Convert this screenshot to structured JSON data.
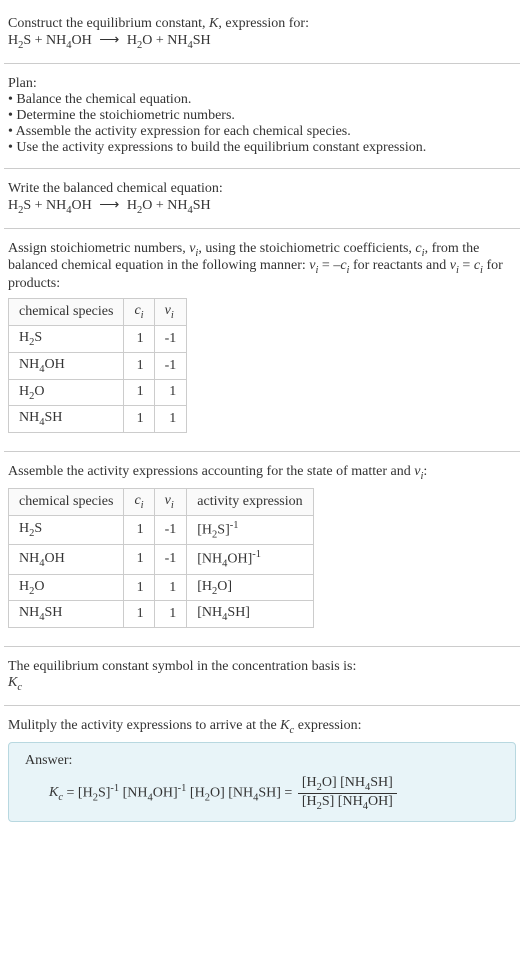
{
  "title": "Construct the equilibrium constant, K, expression for:",
  "reaction_unbalanced": "H₂S + NH₄OH ⟶ H₂O + NH₄SH",
  "plan_header": "Plan:",
  "plan_items": [
    "• Balance the chemical equation.",
    "• Determine the stoichiometric numbers.",
    "• Assemble the activity expression for each chemical species.",
    "• Use the activity expressions to build the equilibrium constant expression."
  ],
  "balanced_header": "Write the balanced chemical equation:",
  "reaction_balanced": "H₂S + NH₄OH ⟶ H₂O + NH₄SH",
  "stoich_header": "Assign stoichiometric numbers, νᵢ, using the stoichiometric coefficients, cᵢ, from the balanced chemical equation in the following manner: νᵢ = –cᵢ for reactants and νᵢ = cᵢ for products:",
  "table1": {
    "headers": [
      "chemical species",
      "cᵢ",
      "νᵢ"
    ],
    "rows": [
      {
        "species": "H₂S",
        "ci": "1",
        "vi": "-1"
      },
      {
        "species": "NH₄OH",
        "ci": "1",
        "vi": "-1"
      },
      {
        "species": "H₂O",
        "ci": "1",
        "vi": "1"
      },
      {
        "species": "NH₄SH",
        "ci": "1",
        "vi": "1"
      }
    ]
  },
  "activity_header": "Assemble the activity expressions accounting for the state of matter and νᵢ:",
  "table2": {
    "headers": [
      "chemical species",
      "cᵢ",
      "νᵢ",
      "activity expression"
    ],
    "rows": [
      {
        "species": "H₂S",
        "ci": "1",
        "vi": "-1",
        "act": "[H₂S]⁻¹"
      },
      {
        "species": "NH₄OH",
        "ci": "1",
        "vi": "-1",
        "act": "[NH₄OH]⁻¹"
      },
      {
        "species": "H₂O",
        "ci": "1",
        "vi": "1",
        "act": "[H₂O]"
      },
      {
        "species": "NH₄SH",
        "ci": "1",
        "vi": "1",
        "act": "[NH₄SH]"
      }
    ]
  },
  "kc_symbol_header": "The equilibrium constant symbol in the concentration basis is:",
  "kc_symbol": "K_c",
  "multiply_header": "Mulitply the activity expressions to arrive at the K_c expression:",
  "answer_label": "Answer:",
  "kc_expr_lhs": "K_c = [H₂S]⁻¹ [NH₄OH]⁻¹ [H₂O] [NH₄SH] = ",
  "frac_top": "[H₂O] [NH₄SH]",
  "frac_bot": "[H₂S] [NH₄OH]",
  "chart_data": {
    "type": "table",
    "tables": [
      {
        "title": "Stoichiometric numbers",
        "headers": [
          "chemical species",
          "c_i",
          "ν_i"
        ],
        "rows": [
          [
            "H2S",
            1,
            -1
          ],
          [
            "NH4OH",
            1,
            -1
          ],
          [
            "H2O",
            1,
            1
          ],
          [
            "NH4SH",
            1,
            1
          ]
        ]
      },
      {
        "title": "Activity expressions",
        "headers": [
          "chemical species",
          "c_i",
          "ν_i",
          "activity expression"
        ],
        "rows": [
          [
            "H2S",
            1,
            -1,
            "[H2S]^-1"
          ],
          [
            "NH4OH",
            1,
            -1,
            "[NH4OH]^-1"
          ],
          [
            "H2O",
            1,
            1,
            "[H2O]"
          ],
          [
            "NH4SH",
            1,
            1,
            "[NH4SH]"
          ]
        ]
      }
    ]
  }
}
